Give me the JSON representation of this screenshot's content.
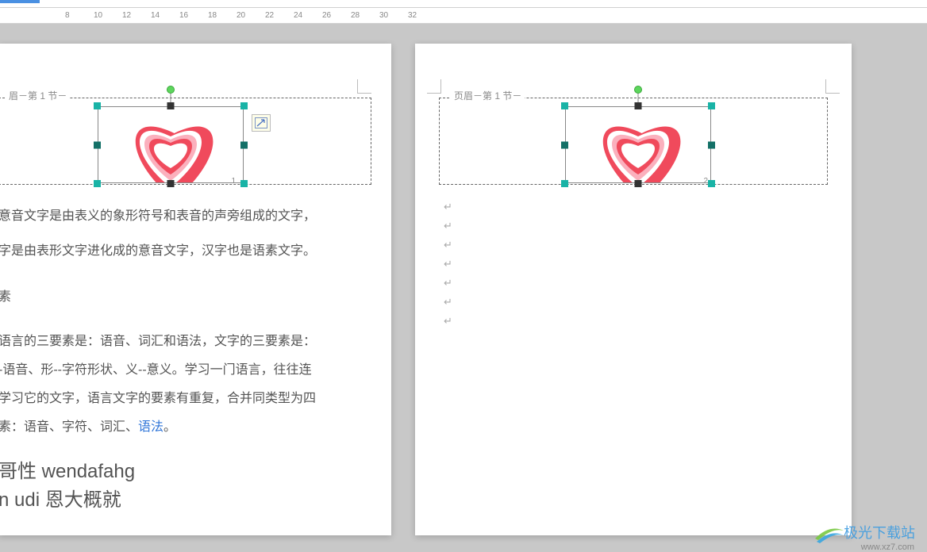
{
  "ruler": {
    "marks": [
      "8",
      "10",
      "12",
      "14",
      "16",
      "18",
      "20",
      "22",
      "24",
      "26",
      "28",
      "30",
      "32"
    ]
  },
  "page1": {
    "header_label": "眉－第 1 节－",
    "page_number": "1",
    "para1": "意音文字是由表义的象形符号和表音的声旁组成的文字，",
    "para2": "字是由表形文字进化成的意音文字，汉字也是语素文字。",
    "section_small": "素",
    "para3": "语言的三要素是：语音、词汇和语法，文字的三要素是：",
    "para4": "-语音、形--字符形状、义--意义。学习一门语言，往往连",
    "para5": "学习它的文字，语言文字的要素有重复，合并同类型为四",
    "para6a": "素：语音、字符、词汇、",
    "para6_link": "语法",
    "para6b": "。",
    "heading1": "哥性 wendafahg",
    "heading2": "n udi 恩大概就"
  },
  "page2": {
    "header_label": "页眉－第 1 节－",
    "page_number": "2"
  },
  "watermark": {
    "brand": "极光下载站",
    "url": "www.xz7.com"
  },
  "icons": {
    "tool_float": "arrow-diagonal",
    "heart": "heart-concentric"
  },
  "colors": {
    "heart_outer": "#f04a5c",
    "heart_mid": "#fbb0bd",
    "heart_inner_white": "#ffffff",
    "sel_handle": "#19b3a6"
  }
}
